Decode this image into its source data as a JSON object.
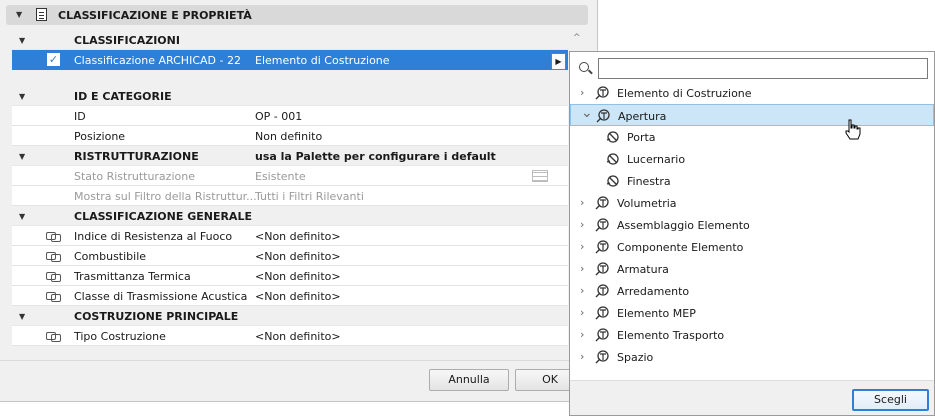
{
  "panel": {
    "title": "CLASSIFICAZIONE E PROPRIETÀ"
  },
  "rows": [
    {
      "type": "section",
      "label": "CLASSIFICAZIONI",
      "value": ""
    },
    {
      "type": "selected",
      "label": "Classificazione ARCHICAD - 22",
      "value": "Elemento di Costruzione"
    },
    {
      "type": "spacer",
      "label": "",
      "value": ""
    },
    {
      "type": "section",
      "label": "ID E CATEGORIE",
      "value": ""
    },
    {
      "type": "item",
      "label": "ID",
      "value": "OP - 001"
    },
    {
      "type": "item",
      "label": "Posizione",
      "value": "Non definito"
    },
    {
      "type": "section",
      "label": "RISTRUTTURAZIONE",
      "value": "usa la Palette per configurare i default"
    },
    {
      "type": "dim",
      "label": "Stato Ristrutturazione",
      "value": "Esistente"
    },
    {
      "type": "dim",
      "label": "Mostra sul Filtro della Ristruttur...",
      "value": "Tutti i Filtri Rilevanti"
    },
    {
      "type": "section",
      "label": "CLASSIFICAZIONE GENERALE",
      "value": ""
    },
    {
      "type": "linked",
      "label": "Indice di Resistenza al Fuoco",
      "value": "<Non definito>"
    },
    {
      "type": "linked",
      "label": "Combustibile",
      "value": "<Non definito>"
    },
    {
      "type": "linked",
      "label": "Trasmittanza Termica",
      "value": "<Non definito>"
    },
    {
      "type": "linked",
      "label": "Classe di Trasmissione Acustica",
      "value": "<Non definito>"
    },
    {
      "type": "section",
      "label": "COSTRUZIONE PRINCIPALE",
      "value": ""
    },
    {
      "type": "linked",
      "label": "Tipo Costruzione",
      "value": "<Non definito>"
    }
  ],
  "buttons": {
    "cancel": "Annulla",
    "ok": "OK"
  },
  "popup": {
    "search": {
      "value": "",
      "placeholder": ""
    },
    "tree": [
      {
        "label": "Elemento di Costruzione",
        "level": 0,
        "expander": "collapsed",
        "icon": "class-icon"
      },
      {
        "label": "Apertura",
        "level": 0,
        "expander": "expanded",
        "icon": "class-icon",
        "selected": true
      },
      {
        "label": "Porta",
        "level": 1,
        "expander": "none",
        "icon": "class-leaf-icon"
      },
      {
        "label": "Lucernario",
        "level": 1,
        "expander": "none",
        "icon": "class-leaf-icon"
      },
      {
        "label": "Finestra",
        "level": 1,
        "expander": "none",
        "icon": "class-leaf-icon"
      },
      {
        "label": "Volumetria",
        "level": 0,
        "expander": "collapsed",
        "icon": "class-icon"
      },
      {
        "label": "Assemblaggio Elemento",
        "level": 0,
        "expander": "collapsed",
        "icon": "class-icon"
      },
      {
        "label": "Componente Elemento",
        "level": 0,
        "expander": "collapsed",
        "icon": "class-icon"
      },
      {
        "label": "Armatura",
        "level": 0,
        "expander": "collapsed",
        "icon": "class-icon"
      },
      {
        "label": "Arredamento",
        "level": 0,
        "expander": "collapsed",
        "icon": "class-icon"
      },
      {
        "label": "Elemento MEP",
        "level": 0,
        "expander": "collapsed",
        "icon": "class-icon"
      },
      {
        "label": "Elemento Trasporto",
        "level": 0,
        "expander": "collapsed",
        "icon": "class-icon"
      },
      {
        "label": "Spazio",
        "level": 0,
        "expander": "collapsed",
        "icon": "class-icon"
      }
    ],
    "pick_button": "Scegli"
  },
  "colors": {
    "selection": "#2d7fd8",
    "tree_selection": "#cde6f7"
  }
}
